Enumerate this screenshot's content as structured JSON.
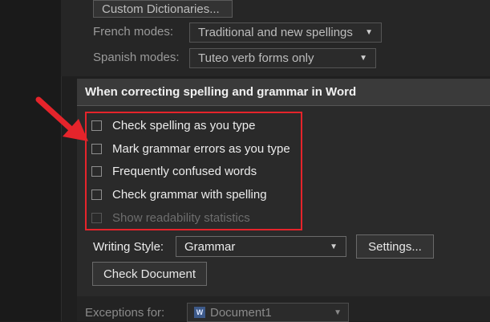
{
  "top": {
    "custom_dictionaries_label": "Custom Dictionaries...",
    "french_modes_label": "French modes:",
    "french_modes_value": "Traditional and new spellings",
    "spanish_modes_label": "Spanish modes:",
    "spanish_modes_value": "Tuteo verb forms only"
  },
  "section": {
    "header": "When correcting spelling and grammar in Word",
    "options": [
      {
        "label": "Check spelling as you type",
        "checked": false,
        "enabled": true
      },
      {
        "label": "Mark grammar errors as you type",
        "checked": false,
        "enabled": true
      },
      {
        "label": "Frequently confused words",
        "checked": false,
        "enabled": true
      },
      {
        "label": "Check grammar with spelling",
        "checked": false,
        "enabled": true
      },
      {
        "label": "Show readability statistics",
        "checked": false,
        "enabled": false
      }
    ],
    "writing_style_label": "Writing Style:",
    "writing_style_value": "Grammar",
    "settings_label": "Settings...",
    "check_document_label": "Check Document"
  },
  "bottom": {
    "exceptions_label": "Exceptions for:",
    "document_value": "Document1"
  },
  "colors": {
    "annotation": "#e5242b",
    "background": "#1f1f1f",
    "header_background": "#3a3a3a"
  },
  "icons": [
    "dropdown-arrow-icon",
    "word-document-icon",
    "red-annotation-arrow-icon"
  ]
}
